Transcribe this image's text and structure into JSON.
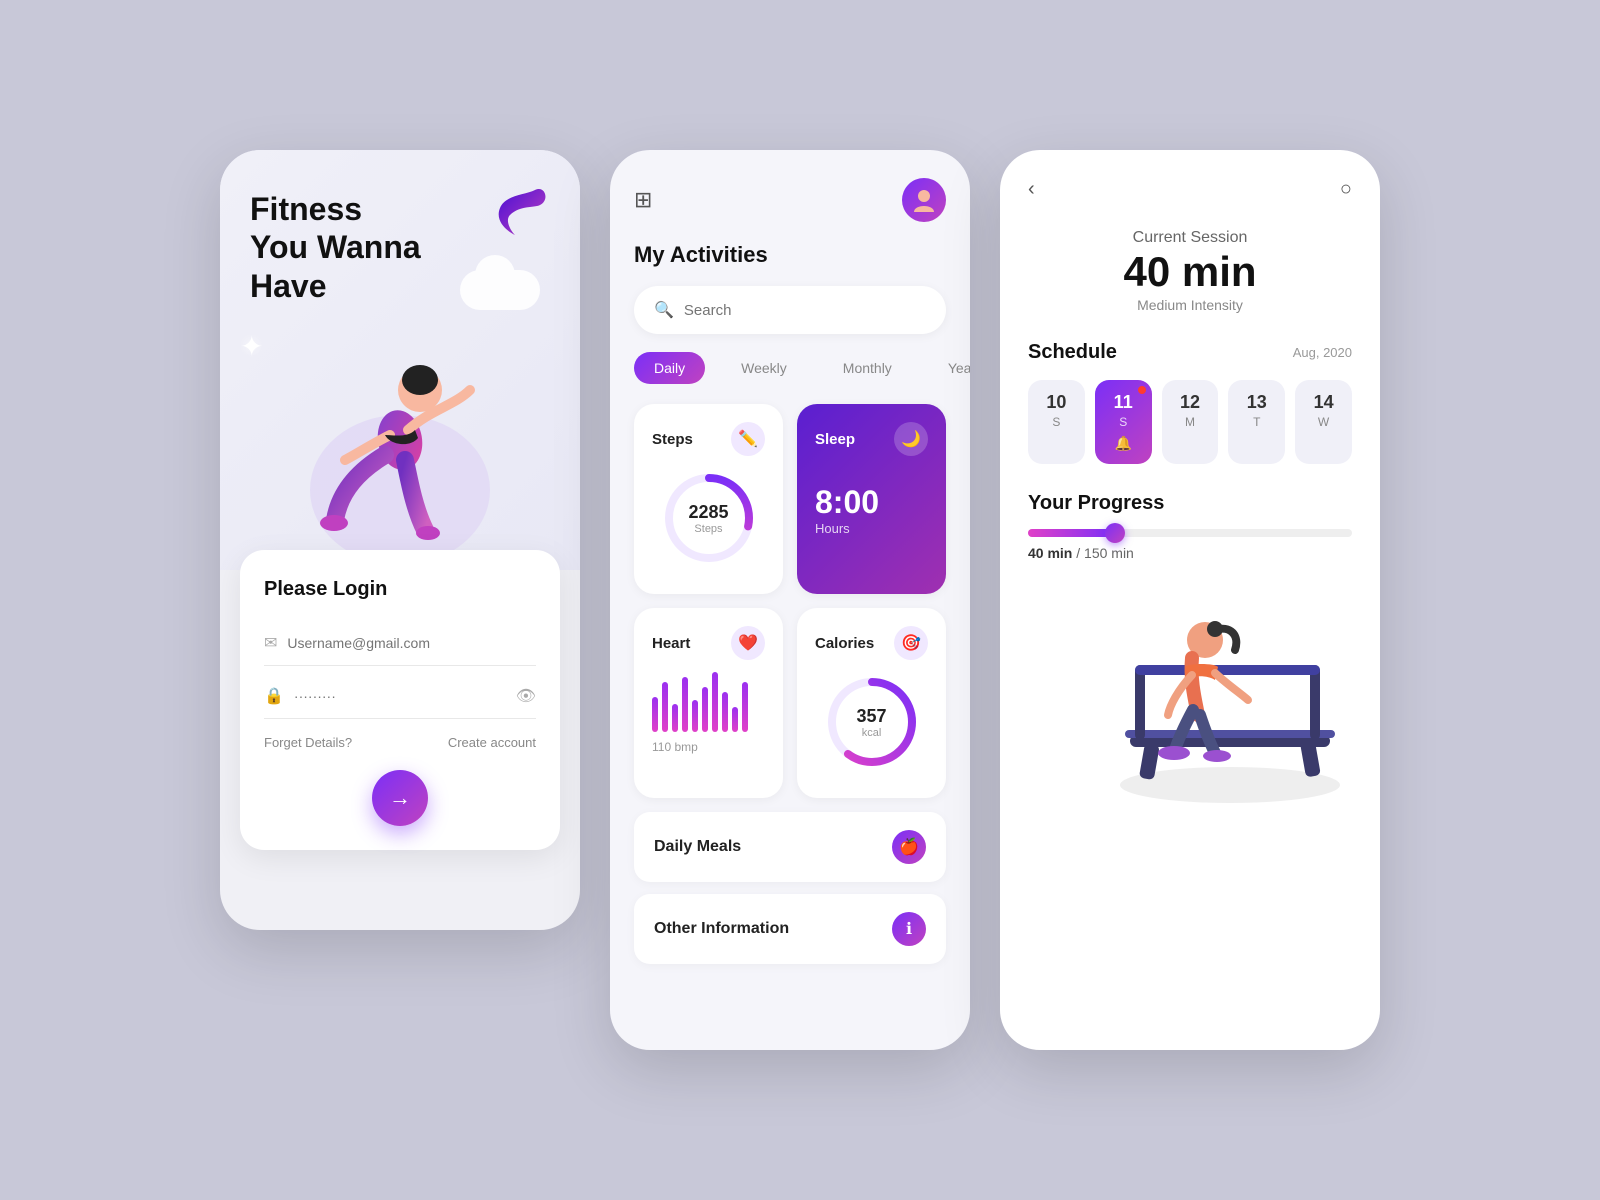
{
  "screen1": {
    "title_line1": "Fitness",
    "title_line2": "You Wanna",
    "title_line3": "Have",
    "login_title": "Please Login",
    "email_placeholder": "Username@gmail.com",
    "password_placeholder": "·········",
    "forget_details": "Forget Details?",
    "create_account": "Create account",
    "arrow": "→"
  },
  "screen2": {
    "section_title": "My Activities",
    "search_placeholder": "Search",
    "tabs": [
      "Daily",
      "Weekly",
      "Monthly",
      "Yearly"
    ],
    "active_tab": "Daily",
    "steps_title": "Steps",
    "steps_value": "2285",
    "steps_unit": "Steps",
    "sleep_title": "Sleep",
    "sleep_value": "8:00",
    "sleep_unit": "Hours",
    "heart_title": "Heart",
    "heart_bpm": "110 bmp",
    "calories_title": "Calories",
    "calories_value": "357",
    "calories_unit": "kcal",
    "daily_meals": "Daily Meals",
    "other_info": "Other Information"
  },
  "screen3": {
    "session_label": "Current Session",
    "session_min": "40 min",
    "session_intensity": "Medium Intensity",
    "schedule_title": "Schedule",
    "schedule_date": "Aug, 2020",
    "days": [
      {
        "num": "10",
        "letter": "S"
      },
      {
        "num": "11",
        "letter": "S"
      },
      {
        "num": "12",
        "letter": "M"
      },
      {
        "num": "13",
        "letter": "T"
      },
      {
        "num": "14",
        "letter": "W"
      }
    ],
    "active_day_index": 1,
    "progress_title": "Your Progress",
    "progress_current": "40 min",
    "progress_total": "150 min",
    "progress_percent": 27
  }
}
